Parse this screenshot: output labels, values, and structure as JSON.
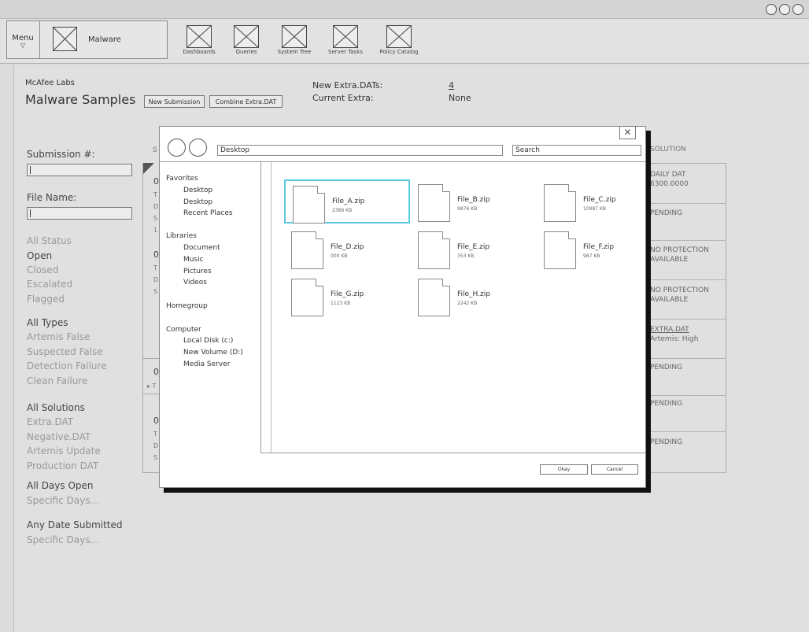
{
  "toolbar": {
    "menu_label": "Menu",
    "menu_arrow": "▽",
    "app_name": "Malware",
    "tabs": [
      {
        "label": "Dashboards"
      },
      {
        "label": "Queries"
      },
      {
        "label": "System Tree"
      },
      {
        "label": "Server Tasks"
      },
      {
        "label": "Policy Catalog"
      }
    ]
  },
  "header": {
    "org": "McAfee Labs",
    "title": "Malware Samples",
    "new_submission_button": "New Submission",
    "combine_button": "Combine Extra.DAT",
    "new_extra_label": "New Extra.DATs:",
    "new_extra_value": "4",
    "current_extra_label": "Current Extra:",
    "current_extra_value": "None"
  },
  "sidebar": {
    "submission_label": "Submission #:",
    "file_name_label": "File Name:",
    "status_filters": [
      "All Status",
      "Open",
      "Closed",
      "Escalated",
      "Flagged"
    ],
    "type_filters": [
      "All Types",
      "Artemis False",
      "Suspected False",
      "Detection Failure",
      "Clean Failure"
    ],
    "solution_filters": [
      "All Solutions",
      "Extra.DAT",
      "Negative.DAT",
      "Artemis Update",
      "Production DAT"
    ],
    "days_filters": [
      "All Days Open",
      "Specific Days..."
    ],
    "date_filters": [
      "Any Date Submitted",
      "Specific Days..."
    ]
  },
  "table": {
    "left_header": "S",
    "left_fragments": [
      "0",
      "T",
      "D",
      "S",
      "1",
      "0",
      "T",
      "D",
      "S",
      "0",
      "▸ T",
      "0",
      "T",
      "D",
      "S"
    ],
    "solution_header": "SOLUTION",
    "solutions": [
      {
        "line1": "DAILY DAT",
        "line2": "6300.0000"
      },
      {
        "line1": "PENDING",
        "line2": ""
      },
      {
        "line1": "NO PROTECTION",
        "line2": "AVAILABLE"
      },
      {
        "line1": "NO PROTECTION",
        "line2": "AVAILABLE"
      },
      {
        "line1": "EXTRA.DAT",
        "line2": "Artemis: High"
      },
      {
        "line1": "PENDING",
        "line2": ""
      },
      {
        "line1": "PENDING",
        "line2": ""
      },
      {
        "line1": "PENDING",
        "line2": ""
      }
    ]
  },
  "dialog": {
    "close": "✕",
    "path": "Desktop",
    "search_placeholder": "Search",
    "nav": {
      "favorites": "Favorites",
      "favorites_items": [
        "Desktop",
        "Desktop",
        "Recent Places"
      ],
      "libraries": "Libraries",
      "libraries_items": [
        "Document",
        "Music",
        "Pictures",
        "Videos"
      ],
      "homegroup": "Homegroup",
      "computer": "Computer",
      "computer_items": [
        "Local Disk (c:)",
        "New Volume (D:)",
        "Media Server"
      ]
    },
    "files": [
      {
        "name": "File_A.zip",
        "size": "2386 KB",
        "selected": true
      },
      {
        "name": "File_B.zip",
        "size": "9876 KB"
      },
      {
        "name": "File_C.zip",
        "size": "10987 KB"
      },
      {
        "name": "File_D.zip",
        "size": "000 KB"
      },
      {
        "name": "File_E.zip",
        "size": "353 KB"
      },
      {
        "name": "File_F.zip",
        "size": "987 KB"
      },
      {
        "name": "File_G.zip",
        "size": "1123 KB"
      },
      {
        "name": "File_H.zip",
        "size": "2242 KB"
      }
    ],
    "ok_label": "Okay",
    "cancel_label": "Cancel"
  },
  "colors": {
    "selection": "#5ccbe0",
    "shadow": "#111111"
  }
}
